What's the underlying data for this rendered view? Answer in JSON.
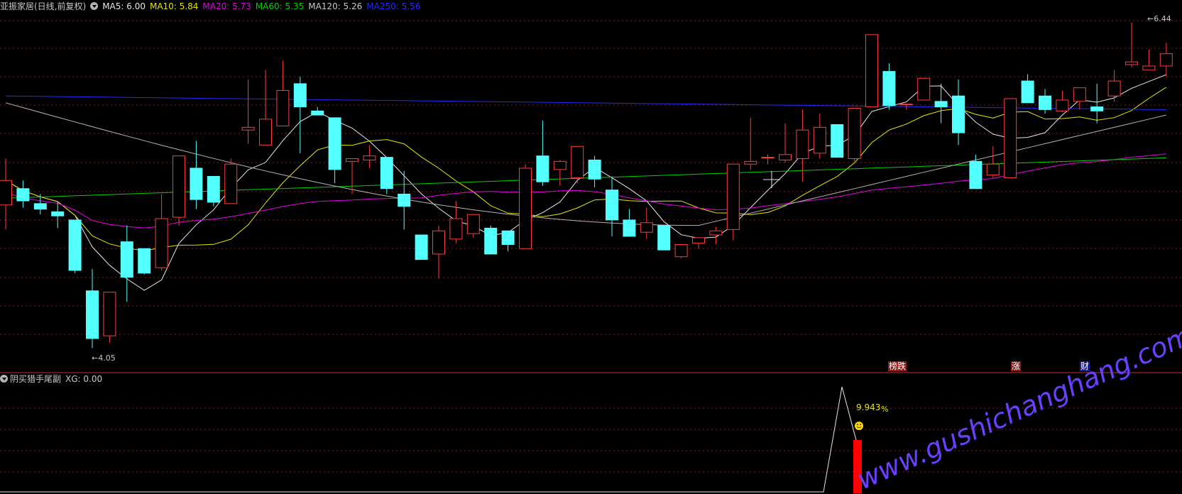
{
  "header": {
    "stock_label": "亚振家居(日线,前复权)",
    "ma": [
      {
        "label": "MA5: 6.00",
        "color": "#e6e6e6"
      },
      {
        "label": "MA10: 5.84",
        "color": "#e6e600"
      },
      {
        "label": "MA20: 5.73",
        "color": "#e600e6"
      },
      {
        "label": "MA60: 5.35",
        "color": "#00d200"
      },
      {
        "label": "MA120: 5.26",
        "color": "#c8c8c8"
      },
      {
        "label": "MA250: 5.56",
        "color": "#2828ff"
      }
    ]
  },
  "price_chart": {
    "high_label": "6.44",
    "low_label": "4.05",
    "up_color": "#ff3c3c",
    "down_color": "#54ffff",
    "candles": [
      [
        5.1,
        5.44,
        4.92,
        5.28
      ],
      [
        5.22,
        5.28,
        5.08,
        5.13
      ],
      [
        5.11,
        5.18,
        5.03,
        5.07
      ],
      [
        5.05,
        5.12,
        4.93,
        5.02
      ],
      [
        4.99,
        4.99,
        4.6,
        4.62
      ],
      [
        4.47,
        4.63,
        4.05,
        4.12
      ],
      [
        4.14,
        4.46,
        4.09,
        4.46
      ],
      [
        4.83,
        4.95,
        4.39,
        4.57
      ],
      [
        4.78,
        4.78,
        4.59,
        4.6
      ],
      [
        4.64,
        5.18,
        4.62,
        5.0
      ],
      [
        5.01,
        5.46,
        4.95,
        5.46
      ],
      [
        5.37,
        5.57,
        5.07,
        5.14
      ],
      [
        5.31,
        5.31,
        5.09,
        5.12
      ],
      [
        5.11,
        5.44,
        5.11,
        5.4
      ],
      [
        5.65,
        6.02,
        5.55,
        5.67
      ],
      [
        5.54,
        6.09,
        5.54,
        5.73
      ],
      [
        5.68,
        6.16,
        5.68,
        5.94
      ],
      [
        5.99,
        6.04,
        5.48,
        5.82
      ],
      [
        5.79,
        5.82,
        5.76,
        5.76
      ],
      [
        5.74,
        5.73,
        5.26,
        5.36
      ],
      [
        5.42,
        5.44,
        5.18,
        5.44
      ],
      [
        5.43,
        5.54,
        5.37,
        5.46
      ],
      [
        5.45,
        5.45,
        5.18,
        5.22
      ],
      [
        5.18,
        5.35,
        4.92,
        5.09
      ],
      [
        4.88,
        4.88,
        4.7,
        4.7
      ],
      [
        4.74,
        4.95,
        4.56,
        4.91
      ],
      [
        4.85,
        5.13,
        4.82,
        5.0
      ],
      [
        4.89,
        5.03,
        4.86,
        5.03
      ],
      [
        4.93,
        4.95,
        4.74,
        4.74
      ],
      [
        4.91,
        4.91,
        4.76,
        4.81
      ],
      [
        4.78,
        5.4,
        4.78,
        5.37
      ],
      [
        5.46,
        5.72,
        5.24,
        5.27
      ],
      [
        5.36,
        5.43,
        5.24,
        5.42
      ],
      [
        5.3,
        5.5,
        5.26,
        5.53
      ],
      [
        5.43,
        5.46,
        5.23,
        5.29
      ],
      [
        5.21,
        5.31,
        4.87,
        4.99
      ],
      [
        4.99,
        5.07,
        4.89,
        4.87
      ],
      [
        4.9,
        5.08,
        4.85,
        4.97
      ],
      [
        4.95,
        4.95,
        4.77,
        4.77
      ],
      [
        4.72,
        4.81,
        4.71,
        4.81
      ],
      [
        4.82,
        4.85,
        4.78,
        4.86
      ],
      [
        4.88,
        4.94,
        4.81,
        4.91
      ],
      [
        4.92,
        4.95,
        4.84,
        5.4
      ],
      [
        5.4,
        5.74,
        5.36,
        5.42
      ],
      [
        5.45,
        5.47,
        5.4,
        5.45
      ],
      [
        5.43,
        5.7,
        5.41,
        5.47
      ],
      [
        5.44,
        5.8,
        5.27,
        5.65
      ],
      [
        5.48,
        5.77,
        5.44,
        5.67
      ],
      [
        5.69,
        5.67,
        5.45,
        5.45
      ],
      [
        5.44,
        5.81,
        5.42,
        5.81
      ],
      [
        5.82,
        6.34,
        5.83,
        6.35
      ],
      [
        6.08,
        6.14,
        5.8,
        5.83
      ],
      [
        5.84,
        5.84,
        5.8,
        5.84
      ],
      [
        5.87,
        6.0,
        5.87,
        6.03
      ],
      [
        5.86,
        5.99,
        5.7,
        5.82
      ],
      [
        5.9,
        6.02,
        5.54,
        5.63
      ],
      [
        5.42,
        5.47,
        5.35,
        5.22
      ],
      [
        5.32,
        5.53,
        5.3,
        5.4
      ],
      [
        5.3,
        5.87,
        5.42,
        5.88
      ],
      [
        6.01,
        6.06,
        5.87,
        5.85
      ],
      [
        5.9,
        5.95,
        5.77,
        5.8
      ],
      [
        5.79,
        5.94,
        5.78,
        5.87
      ],
      [
        5.86,
        5.96,
        5.8,
        5.96
      ],
      [
        5.82,
        5.99,
        5.7,
        5.79
      ],
      [
        5.9,
        6.09,
        5.86,
        6.01
      ],
      [
        6.13,
        6.44,
        6.11,
        6.15
      ],
      [
        6.09,
        6.24,
        6.11,
        6.12
      ],
      [
        6.12,
        6.29,
        6.04,
        6.21
      ]
    ]
  },
  "indicator": {
    "title": "阴买猎手尾副",
    "xg_label": "XG: 0.00",
    "value_text": "9.943",
    "percent_sign": "%",
    "bar_color": "#ff0000"
  },
  "tags": [
    {
      "text": "榜跌",
      "bg": "#8b1a1a",
      "color": "#ffffff"
    },
    {
      "text": "涨",
      "bg": "#8b1a1a",
      "color": "#ffffff"
    },
    {
      "text": "财",
      "bg": "#1a1a8b",
      "color": "#ffffff"
    }
  ],
  "watermark": "www.gushichanghang.com"
}
